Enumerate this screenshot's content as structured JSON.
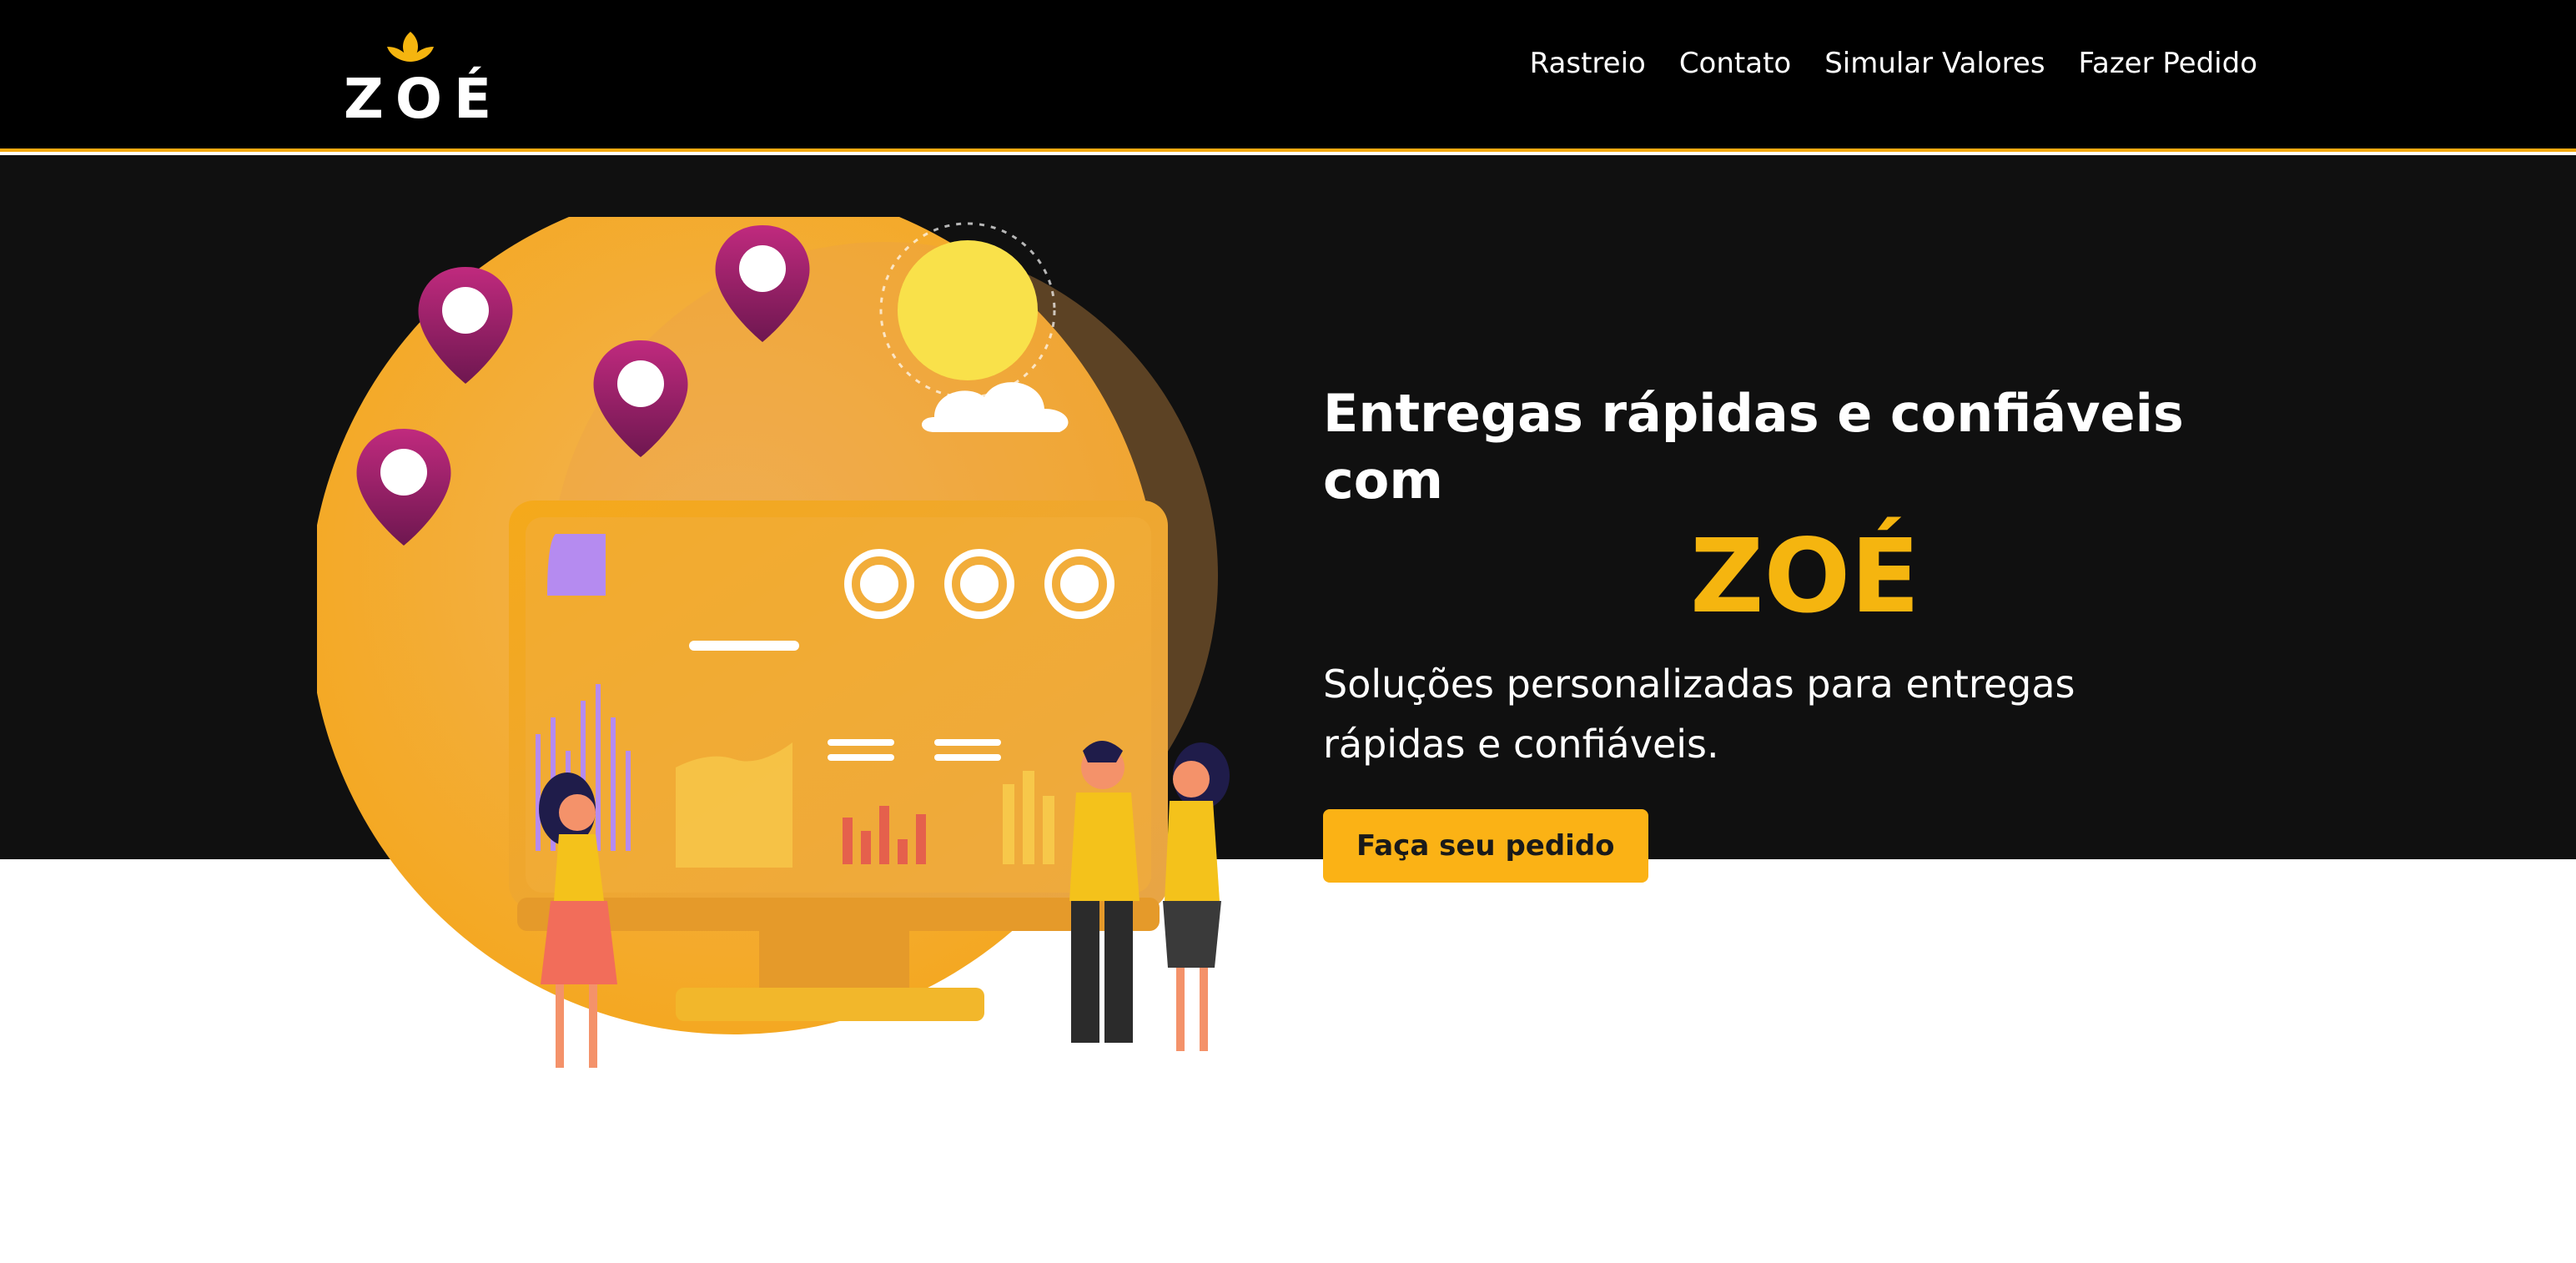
{
  "header": {
    "logo_text": "ZOÉ",
    "nav": [
      "Rastreio",
      "Contato",
      "Simular Valores",
      "Fazer Pedido"
    ]
  },
  "hero": {
    "title": "Entregas rápidas e confiáveis com",
    "brand": "ZOÉ",
    "subtitle": "Soluções personalizadas para entregas rápidas e confiáveis.",
    "cta_label": "Faça seu pedido"
  },
  "colors": {
    "accent": "#f5b50f",
    "background_dark": "#101010",
    "header": "#000000",
    "pin": "#9c1f6b"
  },
  "icons": [
    "leaf-icon",
    "location-pin-icon",
    "monitor-illustration"
  ]
}
